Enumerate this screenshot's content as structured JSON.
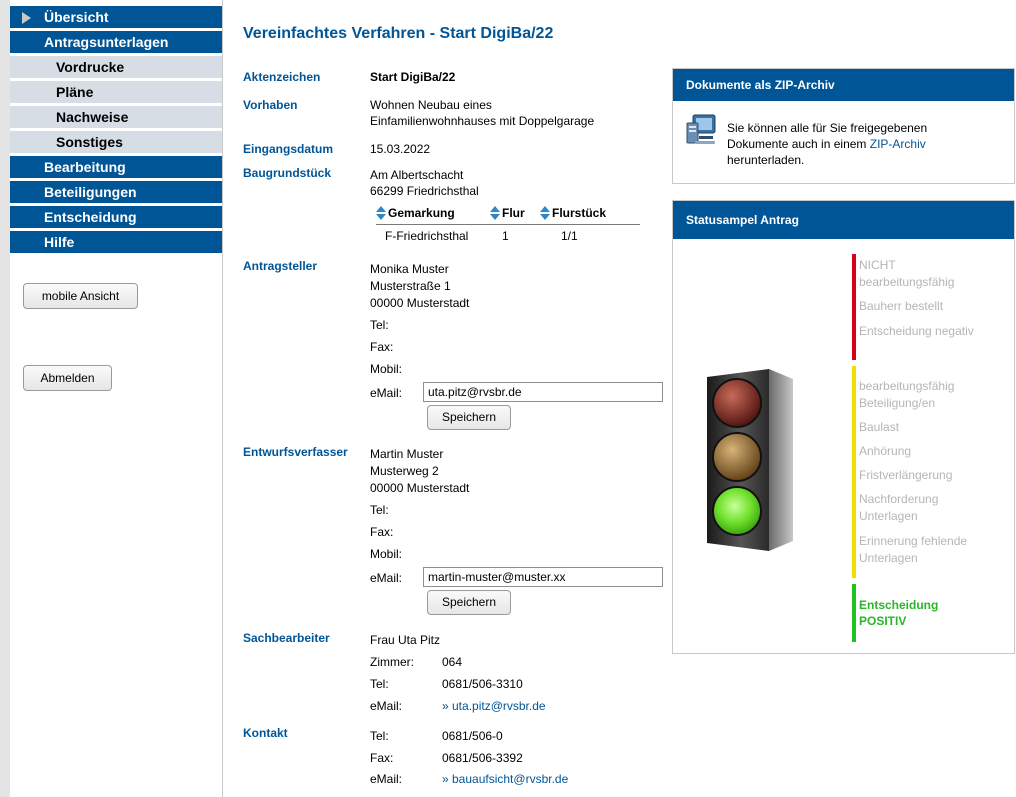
{
  "sidebar": {
    "items": [
      {
        "label": "Übersicht",
        "type": "main"
      },
      {
        "label": "Antragsunterlagen",
        "type": "main"
      },
      {
        "label": "Vordrucke",
        "type": "sub"
      },
      {
        "label": "Pläne",
        "type": "sub"
      },
      {
        "label": "Nachweise",
        "type": "sub"
      },
      {
        "label": "Sonstiges",
        "type": "sub"
      },
      {
        "label": "Bearbeitung",
        "type": "main"
      },
      {
        "label": "Beteiligungen",
        "type": "main"
      },
      {
        "label": "Entscheidung",
        "type": "main"
      },
      {
        "label": "Hilfe",
        "type": "main"
      }
    ],
    "mobile_button": "mobile Ansicht",
    "logout_button": "Abmelden"
  },
  "main": {
    "title": "Vereinfachtes Verfahren - Start DigiBa/22",
    "aktenzeichen": {
      "label": "Aktenzeichen",
      "value": "Start DigiBa/22"
    },
    "vorhaben": {
      "label": "Vorhaben",
      "line1": "Wohnen Neubau eines",
      "line2": "Einfamilienwohnhauses mit Doppelgarage"
    },
    "eingangsdatum": {
      "label": "Eingangsdatum",
      "value": "15.03.2022"
    },
    "baugrundstueck": {
      "label": "Baugrundstück",
      "line1": "Am Albertschacht",
      "line2": "66299 Friedrichsthal",
      "table": {
        "headers": [
          "Gemarkung",
          "Flur",
          "Flurstück"
        ],
        "row": [
          "F-Friedrichsthal",
          "1",
          "1/1"
        ]
      }
    },
    "antragsteller": {
      "label": "Antragsteller",
      "name": "Monika Muster",
      "street": "Musterstraße 1",
      "city": "00000 Musterstadt",
      "tel_label": "Tel:",
      "fax_label": "Fax:",
      "mobil_label": "Mobil:",
      "email_label": "eMail:",
      "email_value": "uta.pitz@rvsbr.de",
      "save_label": "Speichern"
    },
    "entwurfsverfasser": {
      "label": "Entwurfsverfasser",
      "name": "Martin Muster",
      "street": "Musterweg 2",
      "city": "00000 Musterstadt",
      "tel_label": "Tel:",
      "fax_label": "Fax:",
      "mobil_label": "Mobil:",
      "email_label": "eMail:",
      "email_value": "martin-muster@muster.xx",
      "save_label": "Speichern"
    },
    "sachbearbeiter": {
      "label": "Sachbearbeiter",
      "name": "Frau Uta Pitz",
      "zimmer_label": "Zimmer:",
      "zimmer_value": "064",
      "tel_label": "Tel:",
      "tel_value": "0681/506-3310",
      "email_label": "eMail:",
      "email_value": "» uta.pitz@rvsbr.de"
    },
    "kontakt": {
      "label": "Kontakt",
      "tel_label": "Tel:",
      "tel_value": "0681/506-0",
      "fax_label": "Fax:",
      "fax_value": "0681/506-3392",
      "email_label": "eMail:",
      "email_value": "» bauaufsicht@rvsbr.de"
    }
  },
  "zip_panel": {
    "title": "Dokumente als ZIP-Archiv",
    "text1": "Sie können alle für Sie freigegebenen",
    "text2": "Dokumente auch in einem ",
    "link": "ZIP-Archiv",
    "text3": "herunterladen.",
    "icon": "download-computer-icon"
  },
  "status_panel": {
    "title": "Statusampel Antrag",
    "red_items": [
      "NICHT",
      "bearbeitungsfähig",
      "Bauherr bestellt",
      "Entscheidung negativ"
    ],
    "yellow_items": [
      "bearbeitungsfähig",
      "Beteiligung/en",
      "Baulast",
      "Anhörung",
      "Fristverlängerung",
      "Nachforderung",
      "Unterlagen",
      "Erinnerung fehlende",
      "Unterlagen"
    ],
    "green_items": [
      "Entscheidung",
      "POSITIV"
    ],
    "colors": {
      "red": "#d9001b",
      "yellow": "#f0e000",
      "green": "#1fc21f",
      "green_text": "#2ab52a"
    },
    "active": "green"
  }
}
